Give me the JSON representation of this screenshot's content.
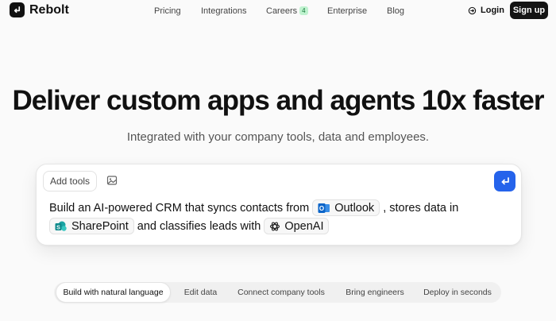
{
  "brand": {
    "name": "Rebolt",
    "logo_icon": "return-arrow-icon"
  },
  "nav": {
    "links": [
      {
        "label": "Pricing"
      },
      {
        "label": "Integrations"
      },
      {
        "label": "Careers",
        "badge": "4"
      },
      {
        "label": "Enterprise"
      },
      {
        "label": "Blog"
      }
    ],
    "login": "Login",
    "signup": "Sign up"
  },
  "hero": {
    "title": "Deliver custom apps and agents 10x faster",
    "subtitle": "Integrated with your company tools, data and employees."
  },
  "prompt": {
    "add_tools": "Add tools",
    "text_1": "Build an AI-powered CRM that syncs contacts from",
    "chip_1": "Outlook",
    "text_2": ", stores data in",
    "chip_2": "SharePoint",
    "text_3": "and classifies leads with",
    "chip_3": "OpenAI"
  },
  "tabs": [
    {
      "label": "Build with natural language",
      "active": true
    },
    {
      "label": "Edit data"
    },
    {
      "label": "Connect company tools"
    },
    {
      "label": "Bring engineers"
    },
    {
      "label": "Deploy in seconds"
    }
  ],
  "colors": {
    "accent": "#2563eb",
    "badge_bg": "#bff2cf",
    "badge_text": "#157a3b",
    "outlook": "#0a64c8",
    "sharepoint": "#0f8a8c"
  }
}
